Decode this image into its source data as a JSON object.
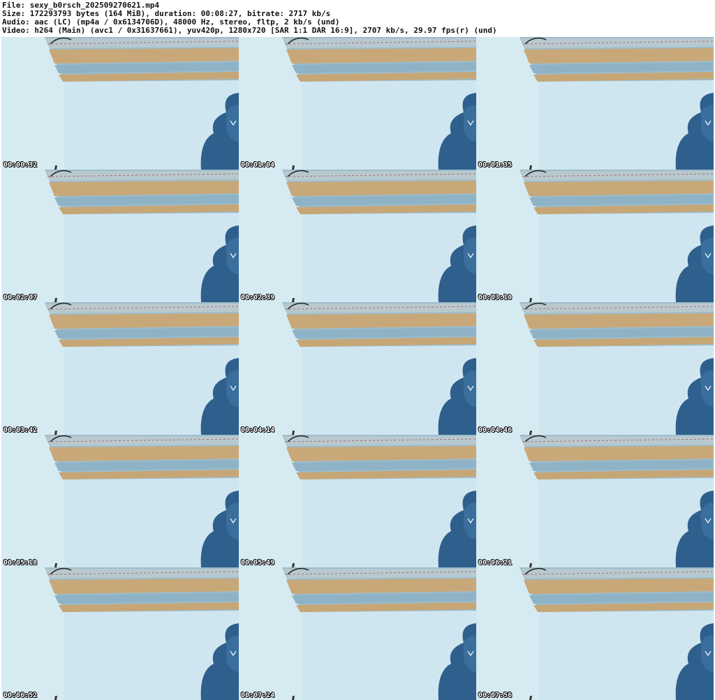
{
  "header": {
    "file_line": "File: sexy_b0rsch_202509270621.mp4",
    "size_line": "Size: 172293793 bytes (164 MiB), duration: 00:08:27, bitrate: 2717 kb/s",
    "audio_line": "Audio: aac (LC) (mp4a / 0x6134706D), 48000 Hz, stereo, fltp, 2 kb/s (und)",
    "video_line": "Video: h264 (Main) (avc1 / 0x31637661), yuv420p, 1280x720 [SAR 1:1 DAR 16:9], 2707 kb/s, 29.97 fps(r) (und)"
  },
  "thumbnails": [
    {
      "timestamp": "00:00:32"
    },
    {
      "timestamp": "00:01:04"
    },
    {
      "timestamp": "00:01:35"
    },
    {
      "timestamp": "00:02:07"
    },
    {
      "timestamp": "00:02:39"
    },
    {
      "timestamp": "00:03:10"
    },
    {
      "timestamp": "00:03:42"
    },
    {
      "timestamp": "00:04:14"
    },
    {
      "timestamp": "00:04:46"
    },
    {
      "timestamp": "00:05:18"
    },
    {
      "timestamp": "00:05:49"
    },
    {
      "timestamp": "00:06:21"
    },
    {
      "timestamp": "00:06:52"
    },
    {
      "timestamp": "00:07:24"
    },
    {
      "timestamp": "00:07:56"
    }
  ],
  "colors": {
    "wall": "#cfe6f0",
    "wall_left": "#d9ebf2",
    "beam_wood": "#c9a877",
    "beam_blue": "#8fb6c8",
    "chair": "#2f5f8c",
    "timestamp_text": "#ffffff"
  }
}
